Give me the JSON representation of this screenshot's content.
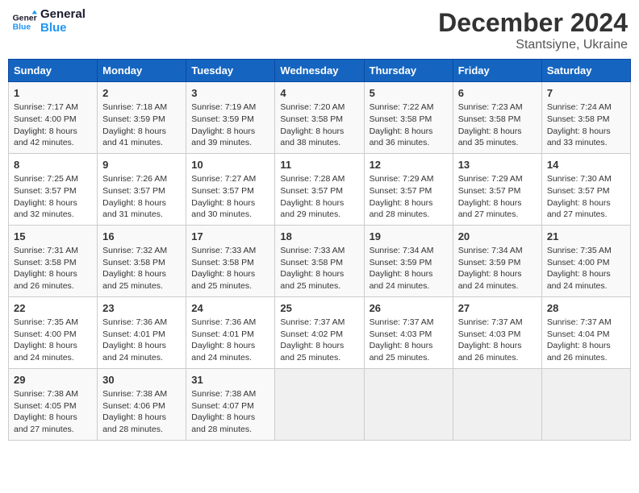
{
  "header": {
    "logo_line1": "General",
    "logo_line2": "Blue",
    "month_year": "December 2024",
    "location": "Stantsiyne, Ukraine"
  },
  "weekdays": [
    "Sunday",
    "Monday",
    "Tuesday",
    "Wednesday",
    "Thursday",
    "Friday",
    "Saturday"
  ],
  "weeks": [
    [
      {
        "day": "1",
        "lines": [
          "Sunrise: 7:17 AM",
          "Sunset: 4:00 PM",
          "Daylight: 8 hours",
          "and 42 minutes."
        ]
      },
      {
        "day": "2",
        "lines": [
          "Sunrise: 7:18 AM",
          "Sunset: 3:59 PM",
          "Daylight: 8 hours",
          "and 41 minutes."
        ]
      },
      {
        "day": "3",
        "lines": [
          "Sunrise: 7:19 AM",
          "Sunset: 3:59 PM",
          "Daylight: 8 hours",
          "and 39 minutes."
        ]
      },
      {
        "day": "4",
        "lines": [
          "Sunrise: 7:20 AM",
          "Sunset: 3:58 PM",
          "Daylight: 8 hours",
          "and 38 minutes."
        ]
      },
      {
        "day": "5",
        "lines": [
          "Sunrise: 7:22 AM",
          "Sunset: 3:58 PM",
          "Daylight: 8 hours",
          "and 36 minutes."
        ]
      },
      {
        "day": "6",
        "lines": [
          "Sunrise: 7:23 AM",
          "Sunset: 3:58 PM",
          "Daylight: 8 hours",
          "and 35 minutes."
        ]
      },
      {
        "day": "7",
        "lines": [
          "Sunrise: 7:24 AM",
          "Sunset: 3:58 PM",
          "Daylight: 8 hours",
          "and 33 minutes."
        ]
      }
    ],
    [
      {
        "day": "8",
        "lines": [
          "Sunrise: 7:25 AM",
          "Sunset: 3:57 PM",
          "Daylight: 8 hours",
          "and 32 minutes."
        ]
      },
      {
        "day": "9",
        "lines": [
          "Sunrise: 7:26 AM",
          "Sunset: 3:57 PM",
          "Daylight: 8 hours",
          "and 31 minutes."
        ]
      },
      {
        "day": "10",
        "lines": [
          "Sunrise: 7:27 AM",
          "Sunset: 3:57 PM",
          "Daylight: 8 hours",
          "and 30 minutes."
        ]
      },
      {
        "day": "11",
        "lines": [
          "Sunrise: 7:28 AM",
          "Sunset: 3:57 PM",
          "Daylight: 8 hours",
          "and 29 minutes."
        ]
      },
      {
        "day": "12",
        "lines": [
          "Sunrise: 7:29 AM",
          "Sunset: 3:57 PM",
          "Daylight: 8 hours",
          "and 28 minutes."
        ]
      },
      {
        "day": "13",
        "lines": [
          "Sunrise: 7:29 AM",
          "Sunset: 3:57 PM",
          "Daylight: 8 hours",
          "and 27 minutes."
        ]
      },
      {
        "day": "14",
        "lines": [
          "Sunrise: 7:30 AM",
          "Sunset: 3:57 PM",
          "Daylight: 8 hours",
          "and 27 minutes."
        ]
      }
    ],
    [
      {
        "day": "15",
        "lines": [
          "Sunrise: 7:31 AM",
          "Sunset: 3:58 PM",
          "Daylight: 8 hours",
          "and 26 minutes."
        ]
      },
      {
        "day": "16",
        "lines": [
          "Sunrise: 7:32 AM",
          "Sunset: 3:58 PM",
          "Daylight: 8 hours",
          "and 25 minutes."
        ]
      },
      {
        "day": "17",
        "lines": [
          "Sunrise: 7:33 AM",
          "Sunset: 3:58 PM",
          "Daylight: 8 hours",
          "and 25 minutes."
        ]
      },
      {
        "day": "18",
        "lines": [
          "Sunrise: 7:33 AM",
          "Sunset: 3:58 PM",
          "Daylight: 8 hours",
          "and 25 minutes."
        ]
      },
      {
        "day": "19",
        "lines": [
          "Sunrise: 7:34 AM",
          "Sunset: 3:59 PM",
          "Daylight: 8 hours",
          "and 24 minutes."
        ]
      },
      {
        "day": "20",
        "lines": [
          "Sunrise: 7:34 AM",
          "Sunset: 3:59 PM",
          "Daylight: 8 hours",
          "and 24 minutes."
        ]
      },
      {
        "day": "21",
        "lines": [
          "Sunrise: 7:35 AM",
          "Sunset: 4:00 PM",
          "Daylight: 8 hours",
          "and 24 minutes."
        ]
      }
    ],
    [
      {
        "day": "22",
        "lines": [
          "Sunrise: 7:35 AM",
          "Sunset: 4:00 PM",
          "Daylight: 8 hours",
          "and 24 minutes."
        ]
      },
      {
        "day": "23",
        "lines": [
          "Sunrise: 7:36 AM",
          "Sunset: 4:01 PM",
          "Daylight: 8 hours",
          "and 24 minutes."
        ]
      },
      {
        "day": "24",
        "lines": [
          "Sunrise: 7:36 AM",
          "Sunset: 4:01 PM",
          "Daylight: 8 hours",
          "and 24 minutes."
        ]
      },
      {
        "day": "25",
        "lines": [
          "Sunrise: 7:37 AM",
          "Sunset: 4:02 PM",
          "Daylight: 8 hours",
          "and 25 minutes."
        ]
      },
      {
        "day": "26",
        "lines": [
          "Sunrise: 7:37 AM",
          "Sunset: 4:03 PM",
          "Daylight: 8 hours",
          "and 25 minutes."
        ]
      },
      {
        "day": "27",
        "lines": [
          "Sunrise: 7:37 AM",
          "Sunset: 4:03 PM",
          "Daylight: 8 hours",
          "and 26 minutes."
        ]
      },
      {
        "day": "28",
        "lines": [
          "Sunrise: 7:37 AM",
          "Sunset: 4:04 PM",
          "Daylight: 8 hours",
          "and 26 minutes."
        ]
      }
    ],
    [
      {
        "day": "29",
        "lines": [
          "Sunrise: 7:38 AM",
          "Sunset: 4:05 PM",
          "Daylight: 8 hours",
          "and 27 minutes."
        ]
      },
      {
        "day": "30",
        "lines": [
          "Sunrise: 7:38 AM",
          "Sunset: 4:06 PM",
          "Daylight: 8 hours",
          "and 28 minutes."
        ]
      },
      {
        "day": "31",
        "lines": [
          "Sunrise: 7:38 AM",
          "Sunset: 4:07 PM",
          "Daylight: 8 hours",
          "and 28 minutes."
        ]
      },
      null,
      null,
      null,
      null
    ]
  ]
}
